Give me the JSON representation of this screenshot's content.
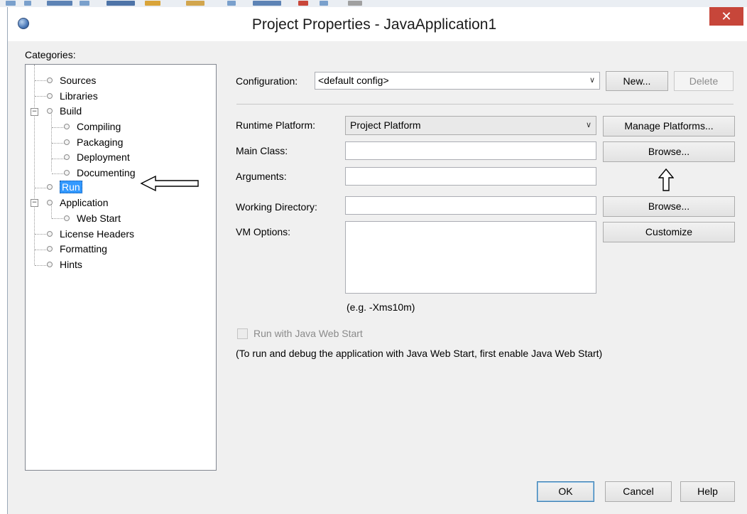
{
  "window": {
    "title": "Project Properties - JavaApplication1",
    "close_symbol": "✕"
  },
  "categories": {
    "label": "Categories:",
    "items": [
      {
        "label": "Sources"
      },
      {
        "label": "Libraries"
      },
      {
        "label": "Build",
        "expanded": true
      },
      {
        "label": "Compiling"
      },
      {
        "label": "Packaging"
      },
      {
        "label": "Deployment"
      },
      {
        "label": "Documenting"
      },
      {
        "label": "Run",
        "selected": true
      },
      {
        "label": "Application",
        "expanded": true
      },
      {
        "label": "Web Start"
      },
      {
        "label": "License Headers"
      },
      {
        "label": "Formatting"
      },
      {
        "label": "Hints"
      }
    ]
  },
  "configuration": {
    "label": "Configuration:",
    "value": "<default config>",
    "new_button": "New...",
    "delete_button": "Delete"
  },
  "run": {
    "runtime_platform_label": "Runtime Platform:",
    "runtime_platform_value": "Project Platform",
    "manage_platforms_button": "Manage Platforms...",
    "main_class_label": "Main Class:",
    "main_class_value": "",
    "browse_button": "Browse...",
    "arguments_label": "Arguments:",
    "arguments_value": "",
    "working_directory_label": "Working Directory:",
    "working_directory_value": "",
    "browse_button_2": "Browse...",
    "vm_options_label": "VM Options:",
    "vm_options_value": "",
    "customize_button": "Customize",
    "vm_hint": "(e.g. -Xms10m)",
    "web_start_checkbox_label": "Run with Java Web Start",
    "web_start_checked": false,
    "web_start_note": "(To run and debug the application with Java Web Start, first enable Java Web Start)"
  },
  "footer": {
    "ok": "OK",
    "cancel": "Cancel",
    "help": "Help"
  },
  "colors": {
    "selection": "#3399ff",
    "close_button": "#c7463a"
  }
}
